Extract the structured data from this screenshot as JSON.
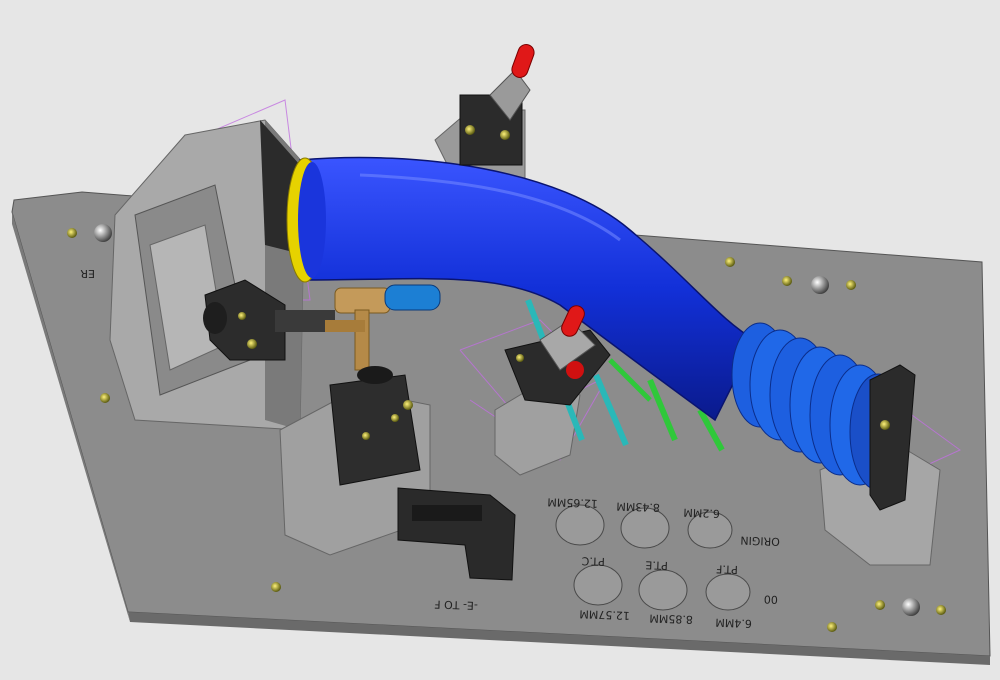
{
  "scene": {
    "background": "#e6e6e6",
    "plate_color": "#8c8c8c",
    "duct_color": "#1230d8",
    "bellows_color": "#1d5fe0",
    "block_color": "#2c2c2c",
    "handle_color": "#e01818",
    "construction_line_color": "#c070e0"
  },
  "labels": {
    "edge_mark": "ER",
    "hole_a": "12.65MM",
    "hole_b": "8.43MM",
    "hole_c": "6.2MM",
    "origin": "ORIGIN",
    "pt_c": "PT.C",
    "pt_e": "PT.E",
    "pt_f": "PT.F",
    "hole_d": "12.57MM",
    "hole_e": "8.85MM",
    "hole_f": "6.4MM",
    "zero_mark": "00",
    "e_to_f": "-E- TO F"
  },
  "icons": [
    "toggle-clamp-icon",
    "bellows-icon",
    "bolt-icon"
  ]
}
